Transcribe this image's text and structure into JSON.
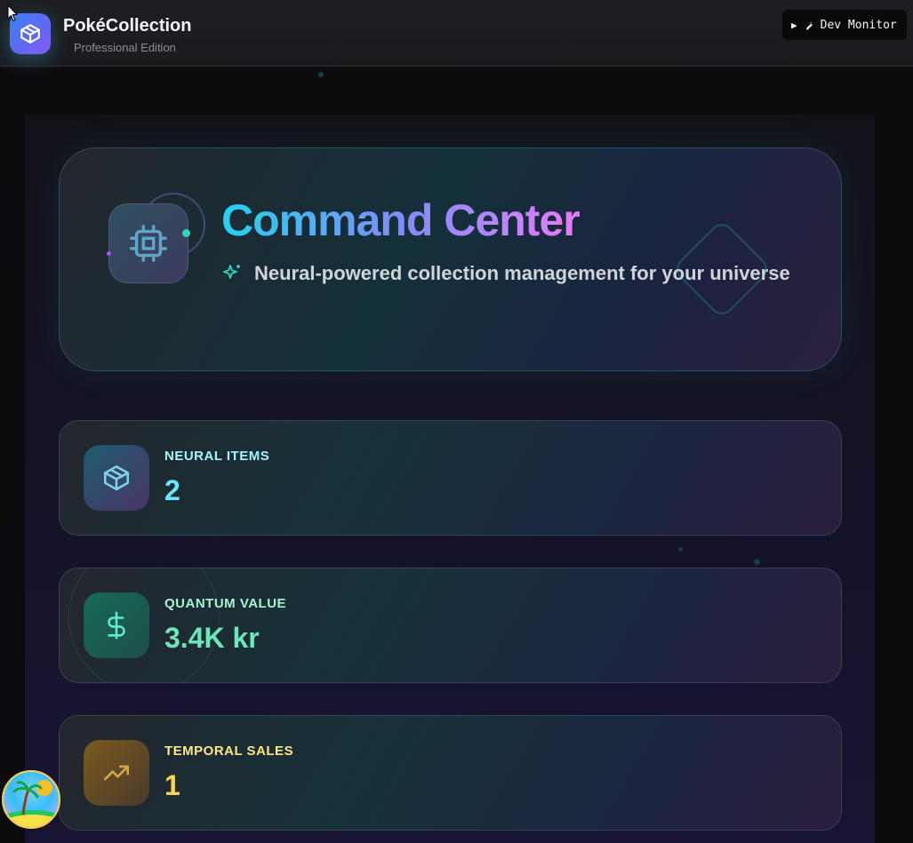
{
  "header": {
    "brand_name": "PokéCollection",
    "brand_subtitle": "Professional Edition",
    "dev_monitor_label": "Dev Monitor",
    "dev_monitor_icon": "wrench-icon"
  },
  "hero": {
    "title": "Command Center",
    "subtitle": "Neural-powered collection management for your universe",
    "icon": "cpu-icon",
    "subtitle_icon": "sparkles-icon"
  },
  "stats": [
    {
      "label": "NEURAL ITEMS",
      "value": "2",
      "icon": "package-icon",
      "color": "#67e8f9"
    },
    {
      "label": "QUANTUM VALUE",
      "value": "3.4K kr",
      "icon": "dollar-icon",
      "color": "#6ee7b7"
    },
    {
      "label": "TEMPORAL SALES",
      "value": "1",
      "icon": "trending-up-icon",
      "color": "#fcd34d"
    }
  ],
  "colors": {
    "accent_cyan": "#22d3ee",
    "accent_purple": "#c084fc",
    "background": "#0c0c0e"
  }
}
